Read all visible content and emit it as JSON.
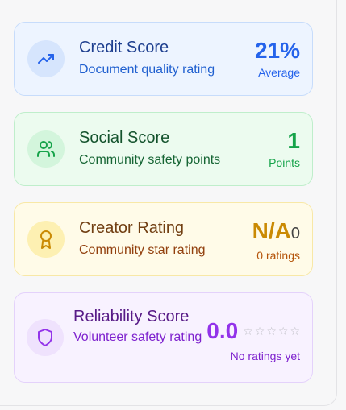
{
  "cards": [
    {
      "id": "credit",
      "title": "Credit Score",
      "subtitle": "Document quality rating",
      "value": "21%",
      "caption": "Average",
      "icon": "trending-up-icon",
      "color": "#2563eb"
    },
    {
      "id": "social",
      "title": "Social Score",
      "subtitle": "Community safety points",
      "value": "1",
      "caption": "Points",
      "icon": "users-icon",
      "color": "#16a34a"
    },
    {
      "id": "creator",
      "title": "Creator Rating",
      "subtitle": "Community star rating",
      "value": "N/A",
      "value_suffix": "0",
      "caption": "0 ratings",
      "icon": "award-icon",
      "color": "#ca8a04"
    },
    {
      "id": "reliability",
      "title": "Reliability Score",
      "subtitle": "Volunteer safety rating",
      "value": "0.0",
      "caption": "No ratings yet",
      "stars_filled": 0,
      "stars_total": 5,
      "icon": "shield-icon",
      "color": "#9333ea"
    }
  ]
}
